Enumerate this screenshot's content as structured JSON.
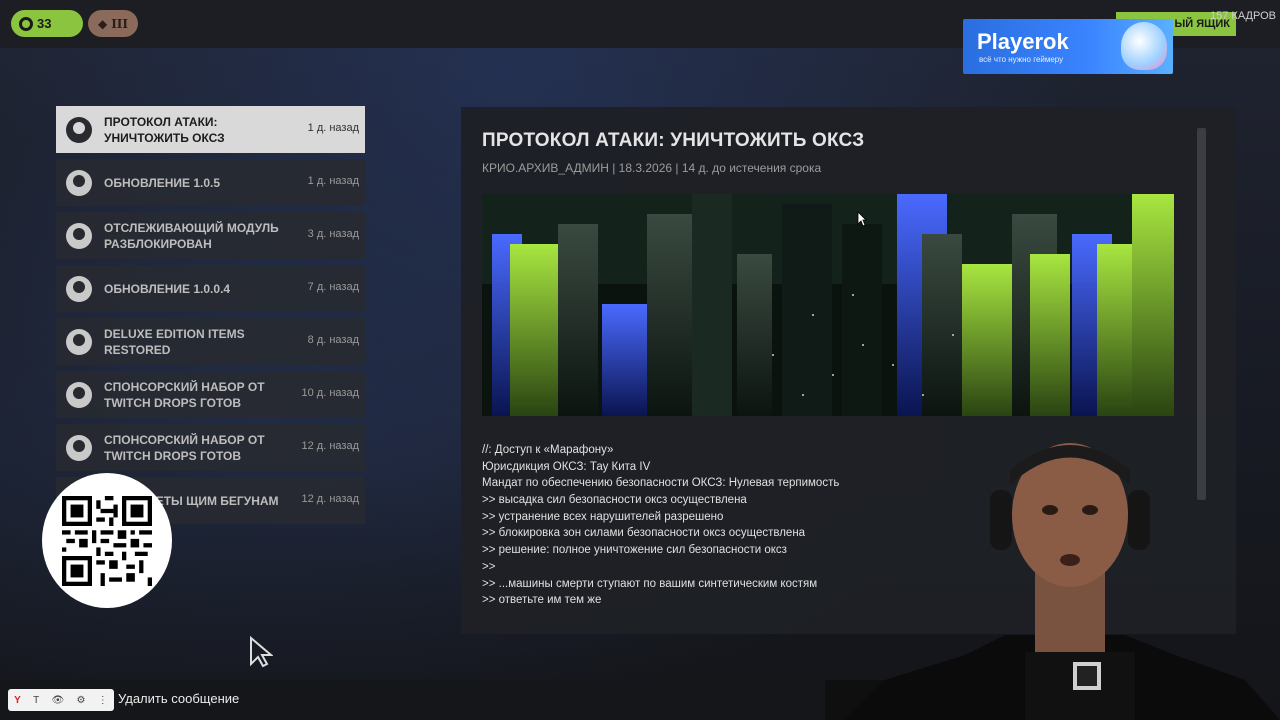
{
  "header": {
    "level": "33",
    "rank": "III",
    "box_label": "ЫЙ ЯЩИК",
    "frames_label": "157 КАДРОВ"
  },
  "ad": {
    "title": "Playerok",
    "subtitle": "всё что нужно геймеру"
  },
  "news": {
    "items": [
      {
        "title": "ПРОТОКОЛ АТАКИ: УНИЧТОЖИТЬ ОКСЗ",
        "age": "1 д. назад",
        "active": true
      },
      {
        "title": "ОБНОВЛЕНИЕ 1.0.5",
        "age": "1 д. назад"
      },
      {
        "title": "ОТСЛЕЖИВАЮЩИЙ МОДУЛЬ РАЗБЛОКИРОВАН",
        "age": "3 д. назад"
      },
      {
        "title": "ОБНОВЛЕНИЕ 1.0.0.4",
        "age": "7 д. назад"
      },
      {
        "title": "DELUXE EDITION ITEMS RESTORED",
        "age": "8 д. назад"
      },
      {
        "title": "СПОНСОРСКИЙ НАБОР ОТ TWITCH DROPS ГОТОВ",
        "age": "10 д. назад"
      },
      {
        "title": "СПОНСОРСКИЙ НАБОР ОТ TWITCH DROPS ГОТОВ",
        "age": "12 д. назад"
      },
      {
        "title": "ON: СОВЕТЫ ЩИМ БЕГУНАМ",
        "age": "12 д. назад"
      }
    ]
  },
  "post": {
    "title": "ПРОТОКОЛ АТАКИ: УНИЧТОЖИТЬ ОКСЗ",
    "meta": "КРИО.АРХИВ_АДМИН | 18.3.2026 | 14 д. до истечения срока",
    "body": [
      "//: Доступ к «Марафону»",
      "Юрисдикция ОКСЗ: Тау Кита IV",
      "Мандат по обеспечению безопасности ОКСЗ: Нулевая терпимость",
      ">> высадка сил безопасности оксз осуществлена",
      ">> устранение всех нарушителей разрешено",
      ">> блокировка зон силами безопасности оксз осуществлена",
      ">> решение: полное уничтожение сил безопасности оксз",
      ">>",
      ">> ...машины смерти ступают по вашим синтетическим костям",
      ">> ответьте им тем же"
    ]
  },
  "chat": {
    "tools": [
      "Y",
      "T",
      "👁",
      "⚙",
      "⋮"
    ],
    "delete_label": "Удалить сообщение"
  },
  "colors": {
    "accent": "#8bc53f",
    "rank": "#8a6a5a",
    "ad": "#3a84ff"
  }
}
